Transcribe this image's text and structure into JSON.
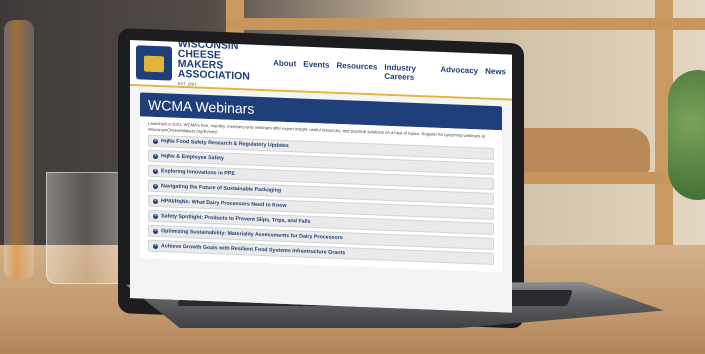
{
  "site": {
    "org_name_line1": "WISCONSIN",
    "org_name_line2": "CHEESE MAKERS",
    "org_name_line3": "ASSOCIATION",
    "established": "EST. 1891"
  },
  "nav": {
    "items": [
      "About",
      "Events",
      "Resources",
      "Industry Careers",
      "Advocacy",
      "News"
    ]
  },
  "page": {
    "title": "WCMA Webinars",
    "intro": "Launched in 2021, WCMA's free, monthly, members-only webinars offer expert insight, useful resources, and practical solutions on a host of topics. Register for upcoming webinars at WisconsinCheeseMakers.org/Events!"
  },
  "webinars": [
    "HqNs Food Safety Research & Regulatory Updates",
    "HqNs & Employee Safety",
    "Exploring Innovations in PPE",
    "Navigating the Future of Sustainable Packaging",
    "HPAI/HqNs: What Dairy Processors Need to Know",
    "Safety Spotlight: Products to Prevent Slips, Trips, and Falls",
    "Optimizing Sustainability: Materiality Assessments for Dairy Processors",
    "Achieve Growth Goals with Resilient Food Systems Infrastructure Grants"
  ]
}
